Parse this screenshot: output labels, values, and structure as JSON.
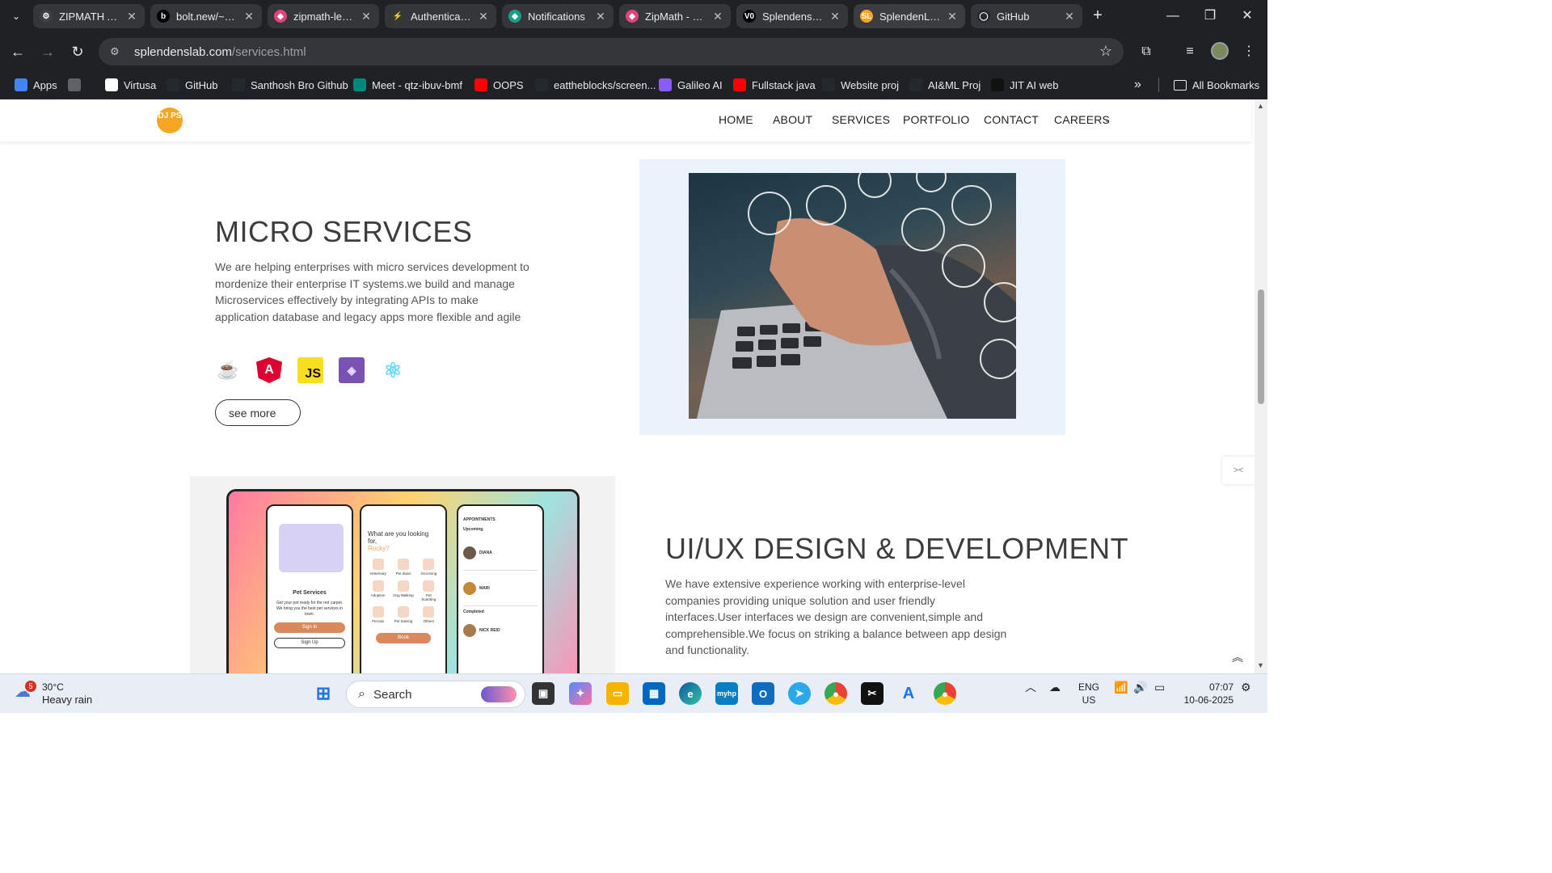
{
  "browser": {
    "tabs": [
      {
        "label": "ZIPMATH App",
        "fav_color": "#3c4043",
        "fav_glyph": "⚙"
      },
      {
        "label": "bolt.new/~/sb",
        "fav_color": "#000000",
        "fav_glyph": "b"
      },
      {
        "label": "zipmath-learn",
        "fav_color": "#e0447a",
        "fav_glyph": "◆"
      },
      {
        "label": "Authentication",
        "fav_color": "#2f3b34",
        "fav_glyph": "⚡"
      },
      {
        "label": "Notifications",
        "fav_color": "#16a08a",
        "fav_glyph": "◆"
      },
      {
        "label": "ZipMath - Lea",
        "fav_color": "#e0447a",
        "fav_glyph": "◆"
      },
      {
        "label": "Splendenslab",
        "fav_color": "#000000",
        "fav_glyph": "V0"
      },
      {
        "label": "SplendenLab",
        "fav_color": "#f5a623",
        "fav_glyph": "SL"
      },
      {
        "label": "GitHub",
        "fav_color": "#24292e",
        "fav_glyph": "◯"
      }
    ],
    "url_host": "splendenslab.com",
    "url_path": "/services.html",
    "bookmarks": [
      {
        "label": "Apps",
        "color": "#4285f4"
      },
      {
        "label": "",
        "color": "#5f6368"
      },
      {
        "label": "Virtusa",
        "color": "#ffffff"
      },
      {
        "label": "GitHub",
        "color": "#24292e"
      },
      {
        "label": "Santhosh Bro Github",
        "color": "#24292e"
      },
      {
        "label": "Meet - qtz-ibuv-bmf",
        "color": "#00897b"
      },
      {
        "label": "OOPS",
        "color": "#ff0000"
      },
      {
        "label": "eattheblocks/screen...",
        "color": "#24292e"
      },
      {
        "label": "Galileo AI",
        "color": "#8a5cf6"
      },
      {
        "label": "Fullstack java",
        "color": "#ff0000"
      },
      {
        "label": "Website proj",
        "color": "#24292e"
      },
      {
        "label": "AI&ML Proj",
        "color": "#24292e"
      },
      {
        "label": "JIT AI web",
        "color": "#111111"
      }
    ],
    "all_bookmarks": "All Bookmarks"
  },
  "site": {
    "logo_text": "DJ PS",
    "nav": [
      "HOME",
      "ABOUT",
      "SERVICES",
      "PORTFOLIO",
      "CONTACT",
      "CAREERS"
    ],
    "micro": {
      "title": "MICRO SERVICES",
      "desc": "We are helping enterprises with micro services development to mordenize their enterprise IT systems.we build and manage Microservices effectively by integrating APIs to make application database and legacy apps more flexible and agile",
      "tech_icons": [
        "java-icon",
        "angular-icon",
        "javascript-icon",
        "bootstrap-icon",
        "react-icon"
      ],
      "button": "see more"
    },
    "uiux": {
      "title": "UI/UX DESIGN & DEVELOPMENT",
      "desc": "We have extensive experience working with enterprise-level companies providing unique solution and user friendly interfaces.User interfaces we design are convenient,simple and comprehensible.We focus on striking a balance between app design and functionality."
    },
    "mockup": {
      "screen1": {
        "title": "Pet Services",
        "body": "Get your pet ready for the red carpet. We bring you the best pet services in town.",
        "primary": "Sign In",
        "secondary": "Sign Up"
      },
      "screen2": {
        "heading": "What are you looking for,",
        "name": "Rocky?",
        "cats": [
          "Veterinary",
          "Pet daiso",
          "Grooming",
          "Adoption",
          "Dog Walking",
          "Pet boarding",
          "Pet taxi",
          "Pet training",
          "Others"
        ],
        "button": "Book"
      },
      "screen3": {
        "header": "APPOINTMENTS",
        "upcoming": "Upcoming",
        "completed": "Completed",
        "entries": [
          "DIANA",
          "MARI",
          "NICK REID"
        ]
      }
    }
  },
  "taskbar": {
    "weather_temp": "30°C",
    "weather_desc": "Heavy rain",
    "weather_badge": "5",
    "search": "Search",
    "lang": "ENG",
    "region": "US",
    "time": "07:07",
    "date": "10-06-2025"
  }
}
